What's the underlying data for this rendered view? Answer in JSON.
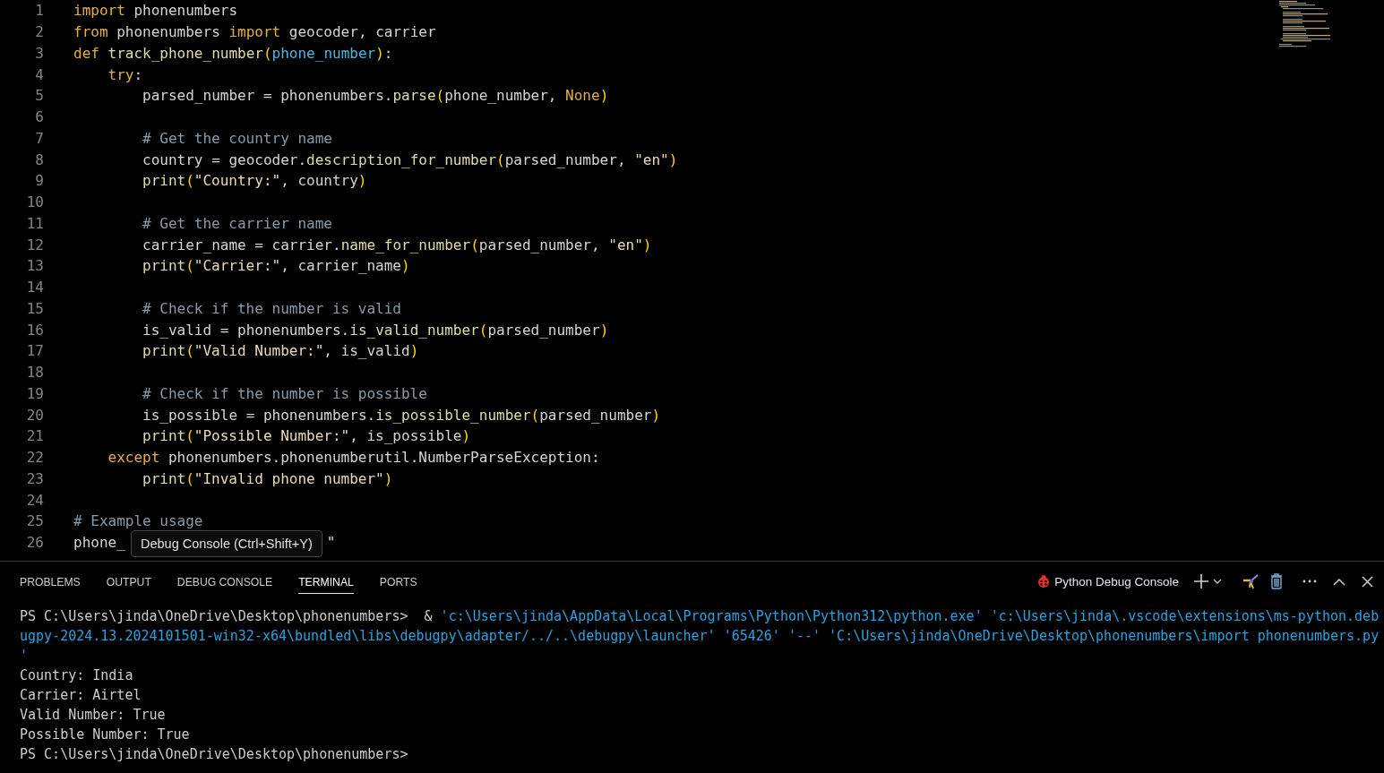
{
  "editor": {
    "lines": [
      {
        "number": "1",
        "tokens": [
          {
            "text": "import",
            "kind": "kw"
          },
          {
            "text": " phonenumbers",
            "kind": "plain"
          }
        ]
      },
      {
        "number": "2",
        "tokens": [
          {
            "text": "from",
            "kind": "kw"
          },
          {
            "text": " phonenumbers ",
            "kind": "plain"
          },
          {
            "text": "import",
            "kind": "kw"
          },
          {
            "text": " geocoder, carrier",
            "kind": "plain"
          }
        ]
      },
      {
        "number": "3",
        "tokens": [
          {
            "text": "def",
            "kind": "kw"
          },
          {
            "text": " track_phone_number",
            "kind": "fn"
          },
          {
            "text": "(",
            "kind": "br"
          },
          {
            "text": "phone_number",
            "kind": "param"
          },
          {
            "text": ")",
            "kind": "br"
          },
          {
            "text": ":",
            "kind": "plain"
          }
        ]
      },
      {
        "number": "4",
        "kind": "block",
        "tokens": [
          {
            "text": "try",
            "kind": "kw"
          },
          {
            "text": ":",
            "kind": "plain"
          }
        ]
      },
      {
        "number": "5",
        "tokens": [
          {
            "text": "        parsed_number = phonenumbers.",
            "kind": "plain"
          },
          {
            "text": "parse",
            "kind": "fn"
          },
          {
            "text": "(",
            "kind": "br"
          },
          {
            "text": "phone_number, ",
            "kind": "plain"
          },
          {
            "text": "None",
            "kind": "const"
          },
          {
            "text": ")",
            "kind": "br"
          }
        ]
      },
      {
        "number": "6"
      },
      {
        "number": "7",
        "kind": "nested",
        "tokens": [
          {
            "text": "# Get the country name",
            "kind": "comment"
          }
        ]
      },
      {
        "number": "8",
        "tokens": [
          {
            "text": "        country = geocoder.",
            "kind": "plain"
          },
          {
            "text": "description_for_number",
            "kind": "fn"
          },
          {
            "text": "(",
            "kind": "br"
          },
          {
            "text": "parsed_number, ",
            "kind": "plain"
          },
          {
            "text": "\"en\"",
            "kind": "str"
          },
          {
            "text": ")",
            "kind": "br"
          }
        ]
      },
      {
        "number": "9",
        "kind": "nested",
        "tokens": [
          {
            "text": "print",
            "kind": "fn"
          },
          {
            "text": "(",
            "kind": "br"
          },
          {
            "text": "\"Country:\"",
            "kind": "str"
          },
          {
            "text": ", country",
            "kind": "plain"
          },
          {
            "text": ")",
            "kind": "br"
          }
        ]
      },
      {
        "number": "10"
      },
      {
        "number": "11",
        "kind": "nested",
        "tokens": [
          {
            "text": "# Get the carrier name",
            "kind": "comment"
          }
        ]
      },
      {
        "number": "12",
        "tokens": [
          {
            "text": "        carrier_name = carrier.",
            "kind": "plain"
          },
          {
            "text": "name_for_number",
            "kind": "fn"
          },
          {
            "text": "(",
            "kind": "br"
          },
          {
            "text": "parsed_number, ",
            "kind": "plain"
          },
          {
            "text": "\"en\"",
            "kind": "str"
          },
          {
            "text": ")",
            "kind": "br"
          }
        ]
      },
      {
        "number": "13",
        "kind": "nested",
        "tokens": [
          {
            "text": "print",
            "kind": "fn"
          },
          {
            "text": "(",
            "kind": "br"
          },
          {
            "text": "\"Carrier:\"",
            "kind": "str"
          },
          {
            "text": ", carrier_name",
            "kind": "plain"
          },
          {
            "text": ")",
            "kind": "br"
          }
        ]
      },
      {
        "number": "14"
      },
      {
        "number": "15",
        "kind": "nested",
        "tokens": [
          {
            "text": "# Check if the number is valid",
            "kind": "comment"
          }
        ]
      },
      {
        "number": "16",
        "tokens": [
          {
            "text": "        is_valid = phonenumbers.",
            "kind": "plain"
          },
          {
            "text": "is_valid_number",
            "kind": "fn"
          },
          {
            "text": "(",
            "kind": "br"
          },
          {
            "text": "parsed_number",
            "kind": "plain"
          },
          {
            "text": ")",
            "kind": "br"
          }
        ]
      },
      {
        "number": "17",
        "kind": "nested",
        "tokens": [
          {
            "text": "print",
            "kind": "fn"
          },
          {
            "text": "(",
            "kind": "br"
          },
          {
            "text": "\"Valid Number:\"",
            "kind": "str"
          },
          {
            "text": ", is_valid",
            "kind": "plain"
          },
          {
            "text": ")",
            "kind": "br"
          }
        ]
      },
      {
        "number": "18"
      },
      {
        "number": "19",
        "kind": "nested",
        "tokens": [
          {
            "text": "# Check if the number is possible",
            "kind": "comment"
          }
        ]
      },
      {
        "number": "20",
        "tokens": [
          {
            "text": "        is_possible = phonenumbers.",
            "kind": "plain"
          },
          {
            "text": "is_possible_number",
            "kind": "fn"
          },
          {
            "text": "(",
            "kind": "br"
          },
          {
            "text": "parsed_number",
            "kind": "plain"
          },
          {
            "text": ")",
            "kind": "br"
          }
        ]
      },
      {
        "number": "21",
        "kind": "nested",
        "tokens": [
          {
            "text": "print",
            "kind": "fn"
          },
          {
            "text": "(",
            "kind": "br"
          },
          {
            "text": "\"Possible Number:\"",
            "kind": "str"
          },
          {
            "text": ", is_possible",
            "kind": "plain"
          },
          {
            "text": ")",
            "kind": "br"
          }
        ]
      },
      {
        "number": "22",
        "kind": "block",
        "tokens": [
          {
            "text": "except",
            "kind": "kw"
          },
          {
            "text": " phonenumbers.phonenumberutil.NumberParseException:",
            "kind": "plain"
          }
        ]
      },
      {
        "number": "23",
        "kind": "nested",
        "tokens": [
          {
            "text": "print",
            "kind": "fn"
          },
          {
            "text": "(",
            "kind": "br"
          },
          {
            "text": "\"Invalid phone number\"",
            "kind": "str"
          },
          {
            "text": ")",
            "kind": "br"
          }
        ]
      },
      {
        "number": "24"
      },
      {
        "number": "25",
        "tokens": [
          {
            "text": "# Example usage",
            "kind": "comment"
          }
        ]
      },
      {
        "number": "26",
        "tokens": [
          {
            "text": "phone_",
            "kind": "plain"
          },
          {
            "text": "\"",
            "kind": "str",
            "covered_before": true
          }
        ]
      }
    ],
    "tooltip": "Debug Console (Ctrl+Shift+Y)"
  },
  "panel": {
    "tabs": [
      {
        "label": "PROBLEMS",
        "selected": false
      },
      {
        "label": "OUTPUT",
        "selected": false
      },
      {
        "label": "DEBUG CONSOLE",
        "selected": false
      },
      {
        "label": "TERMINAL",
        "selected": true
      },
      {
        "label": "PORTS",
        "selected": false
      }
    ],
    "terminal_name": "Python Debug Console",
    "terminal": {
      "command": [
        {
          "text": "PS C:\\Users\\jinda\\OneDrive\\Desktop\\phonenumbers>",
          "kind": "prompt"
        },
        {
          "text": "  & ",
          "kind": "plain"
        },
        {
          "text": "'c:\\Users\\jinda\\AppData\\Local\\Programs\\Python\\Python312\\python.exe' 'c:\\Users\\jinda\\.vscode\\extensions\\ms-python.debugpy-2024.13.2024101501-win32-x64\\bundled\\libs\\debugpy\\adapter/../..\\debugpy\\launcher' '65426' '--' 'C:\\Users\\jinda\\OneDrive\\Desktop\\phonenumbers\\import phonenumbers.py '",
          "kind": "arg"
        }
      ],
      "output": [
        "Country: India",
        "Carrier: Airtel",
        "Valid Number: True",
        "Possible Number: True",
        "PS C:\\Users\\jinda\\OneDrive\\Desktop\\phonenumbers>"
      ]
    }
  }
}
